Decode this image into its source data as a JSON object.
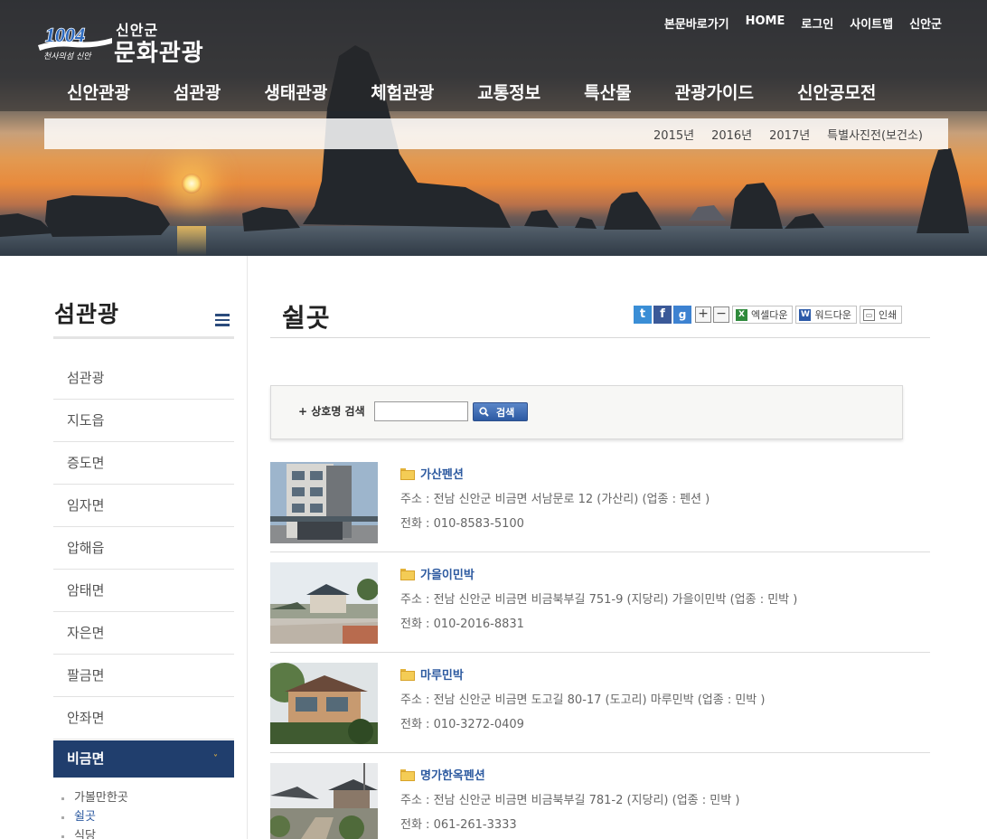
{
  "header": {
    "logo": {
      "emblem_text": "1004",
      "emblem_sub": "천사의섬 신안",
      "small": "신안군",
      "big": "문화관광"
    },
    "util_nav": [
      "본문바로가기",
      "HOME",
      "로그인",
      "사이트맵",
      "신안군"
    ],
    "gnb": [
      "신안관광",
      "섬관광",
      "생태관광",
      "체험관광",
      "교통정보",
      "특산물",
      "관광가이드",
      "신안공모전"
    ],
    "sub_gnb": [
      "2015년",
      "2016년",
      "2017년",
      "특별사진전(보건소)"
    ]
  },
  "sidebar": {
    "title": "섬관광",
    "items": [
      {
        "label": "섬관광"
      },
      {
        "label": "지도읍"
      },
      {
        "label": "증도면"
      },
      {
        "label": "임자면"
      },
      {
        "label": "압해읍"
      },
      {
        "label": "암태면"
      },
      {
        "label": "자은면"
      },
      {
        "label": "팔금면"
      },
      {
        "label": "안좌면"
      }
    ],
    "active": {
      "label": "비금면",
      "arrow": "˅"
    },
    "sub_items": [
      {
        "label": "가볼만한곳"
      },
      {
        "label": "쉴곳"
      },
      {
        "label": "식당"
      }
    ]
  },
  "content": {
    "title": "쉴곳",
    "tools": {
      "twitter": "t",
      "facebook": "f",
      "google": "g",
      "zoom_in": "+",
      "zoom_out": "−",
      "excel_label": "엑셀다운",
      "word_label": "워드다운",
      "print_label": "인쇄",
      "excel_icon": "X",
      "word_icon": "W",
      "print_icon": "▭"
    },
    "search": {
      "label": "+ 상호명 검색",
      "value": "",
      "button_label": "검색"
    },
    "listings": [
      {
        "name": "가산펜션",
        "address": "주소 : 전남 신안군 비금면 서남문로 12 (가산리)  (업종 : 펜션 )",
        "phone": "전화 : 010-8583-5100"
      },
      {
        "name": "가을이민박",
        "address": "주소 : 전남 신안군 비금면 비금북부길 751-9 (지당리) 가을이민박  (업종 : 민박 )",
        "phone": "전화 : 010-2016-8831"
      },
      {
        "name": "마루민박",
        "address": "주소 : 전남 신안군 비금면 도고길 80-17 (도고리) 마루민박  (업종 : 민박 )",
        "phone": "전화 : 010-3272-0409"
      },
      {
        "name": "명가한옥펜션",
        "address": "주소 : 전남 신안군 비금면 비금북부길 781-2 (지당리)  (업종 : 민박 )",
        "phone": "전화 : 061-261-3333"
      }
    ]
  }
}
